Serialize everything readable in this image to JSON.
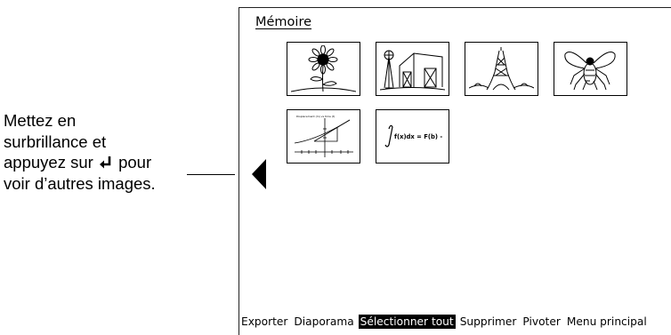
{
  "callout": {
    "line1": "Mettez en",
    "line2": "surbrillance et",
    "line3_before": "appuyez sur",
    "line3_after": "pour",
    "line4": "voir d’autres images.",
    "enter_icon": "enter-return-icon"
  },
  "screen": {
    "section_title": "Mémoire",
    "thumbnails": [
      {
        "name": "sunflower-image"
      },
      {
        "name": "barn-windmill-image"
      },
      {
        "name": "eiffel-tower-image"
      },
      {
        "name": "fly-image"
      },
      {
        "name": "graph-image",
        "caption": "Displacement (m) vs time (t)"
      },
      {
        "name": "integral-formula-image",
        "formula": "f(x)dx = F(b) - F(a)"
      }
    ],
    "prev_arrow_icon": "triangle-left-icon"
  },
  "menu": {
    "items": [
      "Exporter",
      "Diaporama",
      "Sélectionner tout",
      "Supprimer",
      "Pivoter",
      "Menu principal"
    ],
    "selected_index": 2
  }
}
